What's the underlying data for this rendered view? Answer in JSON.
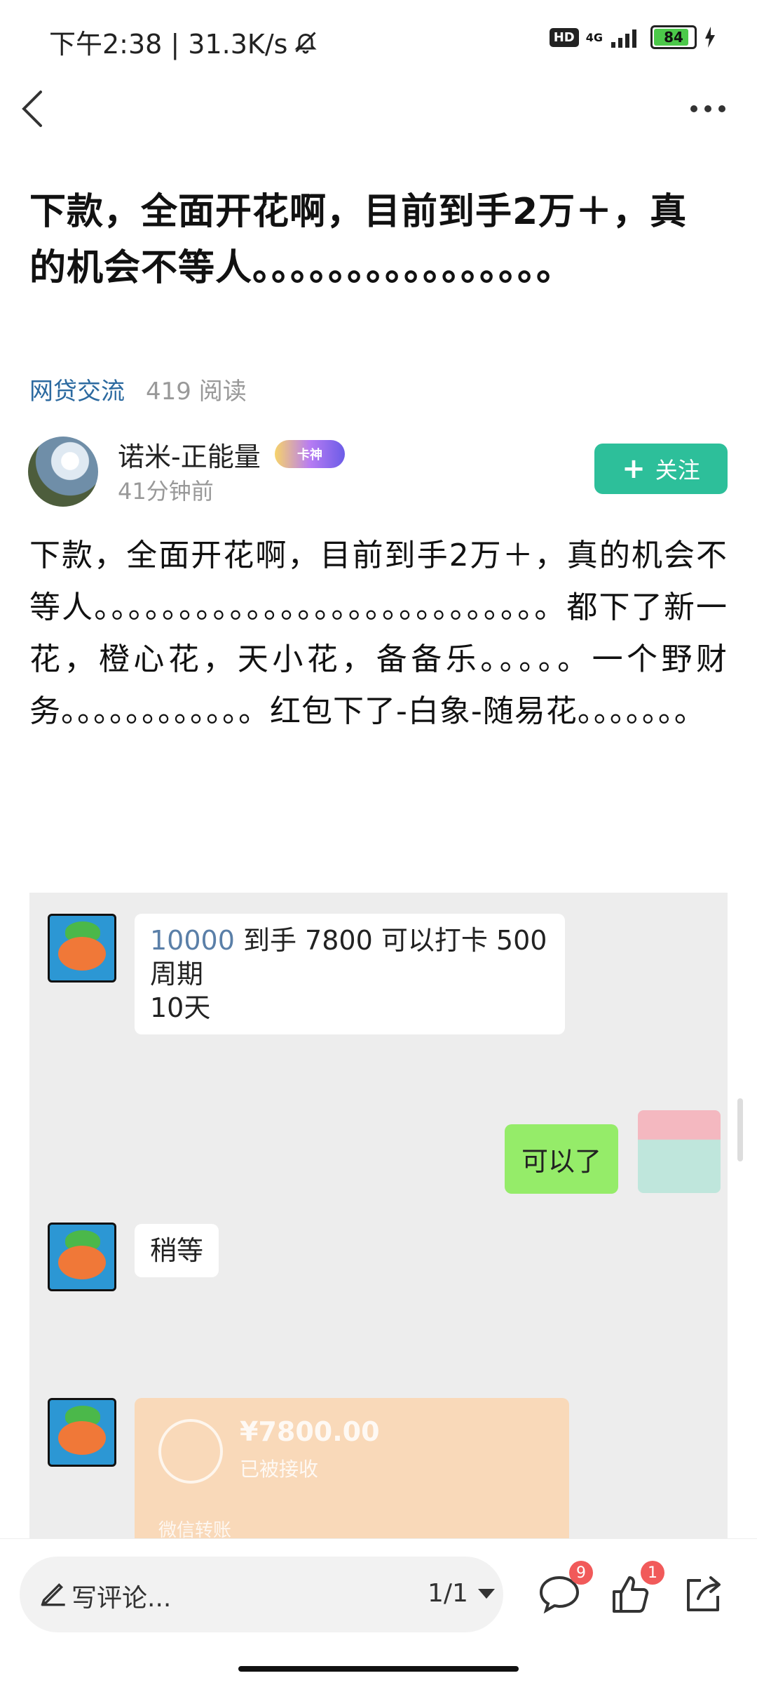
{
  "status_bar": {
    "time_speed": "下午2:38 | 31.3K/s",
    "hd": "HD",
    "network": "4G",
    "battery": "84"
  },
  "article": {
    "title": "下款，全面开花啊，目前到手2万＋，真的机会不等人。。。。。。。。。。。。。。。。",
    "category": "网贷交流",
    "reads": "419 阅读",
    "author": "诺米-正能量",
    "badge": "卡神",
    "time": "41分钟前",
    "follow_label": "关注",
    "body": "下款，全面开花啊，目前到手2万＋，真的机会不等人。。。。。。。。。。。。。。。。。。。。。。。。。。。都下了新一花，橙心花，天小花，备备乐。。。。。一个野财务。。。。。。。。。。。。红包下了-白象-随易花。。。。。。。"
  },
  "chat": {
    "msg1_num": "10000",
    "msg1_rest": " 到手 7800 可以打卡 500 周期",
    "msg1_line2": "10天",
    "reply": "可以了",
    "msg2": "稍等",
    "transfer_amount": "¥7800.00",
    "transfer_status": "已被接收",
    "transfer_label": "微信转账"
  },
  "bottom": {
    "comment_placeholder": "写评论...",
    "pager": "1/1",
    "comment_count": "9",
    "like_count": "1"
  }
}
